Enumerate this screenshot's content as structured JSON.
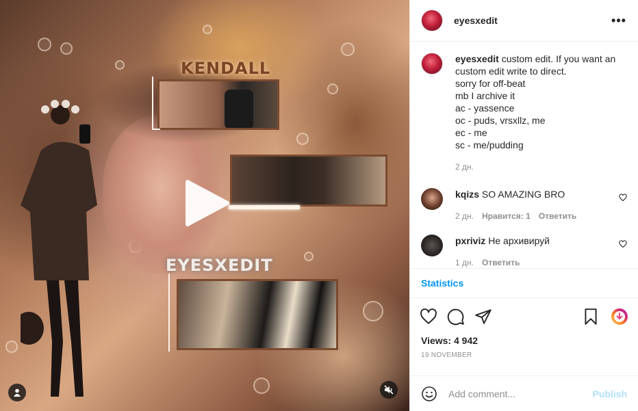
{
  "post": {
    "username": "eyesxedit",
    "more_icon": "more-horizontal-icon",
    "overlay_title_1": "KENDALL",
    "overlay_title_2": "EYESXEDIT"
  },
  "caption": {
    "username": "eyesxedit",
    "lines": [
      "custom edit. If you want an custom edit write to direct.",
      "sorry for off-beat",
      "mb I archive it",
      "ac - yassence",
      "oc - puds, vrsxllz, me",
      "ec - me",
      "sc - me/pudding"
    ],
    "time": "2 дн."
  },
  "comments": [
    {
      "username": "kqizs",
      "text": "SO AMAZING BRO",
      "time": "2 дн.",
      "likes": "Нравится: 1",
      "reply": "Ответить"
    },
    {
      "username": "pxriviz",
      "text": "Не архивируй",
      "time": "1 дн.",
      "likes": "",
      "reply": "Ответить"
    }
  ],
  "statistics_label": "Statistics",
  "views": "Views: 4 942",
  "date": "19 NOVEMBER",
  "add_comment": {
    "placeholder": "Add comment...",
    "publish": "Publish"
  },
  "colors": {
    "accent": "#0095f6",
    "publish_disabled": "#b2dffc",
    "muted": "#8e8e8e"
  }
}
